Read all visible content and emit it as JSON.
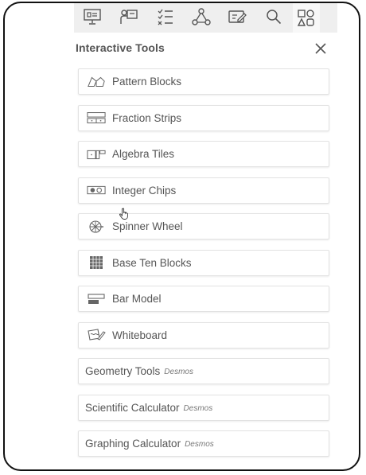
{
  "toolbar": {
    "icons": [
      "presentation-icon",
      "teacher-icon",
      "checklist-icon",
      "network-icon",
      "edit-note-icon",
      "search-icon",
      "shapes-icon"
    ],
    "active": "shapes-icon"
  },
  "panel": {
    "title": "Interactive Tools",
    "close_label": "×"
  },
  "tools": [
    {
      "label": "Pattern Blocks",
      "icon": "pattern-blocks-icon"
    },
    {
      "label": "Fraction Strips",
      "icon": "fraction-strips-icon"
    },
    {
      "label": "Algebra Tiles",
      "icon": "algebra-tiles-icon"
    },
    {
      "label": "Integer Chips",
      "icon": "integer-chips-icon"
    },
    {
      "label": "Spinner Wheel",
      "icon": "spinner-wheel-icon"
    },
    {
      "label": "Base Ten Blocks",
      "icon": "base-ten-blocks-icon"
    },
    {
      "label": "Bar Model",
      "icon": "bar-model-icon"
    },
    {
      "label": "Whiteboard",
      "icon": "whiteboard-icon"
    },
    {
      "label": "Geometry Tools",
      "brand": "Desmos"
    },
    {
      "label": "Scientific Calculator",
      "brand": "Desmos"
    },
    {
      "label": "Graphing Calculator",
      "brand": "Desmos"
    }
  ],
  "colors": {
    "text": "#555555",
    "border": "#e2e2e2",
    "toolbar_bg": "#efefef"
  }
}
